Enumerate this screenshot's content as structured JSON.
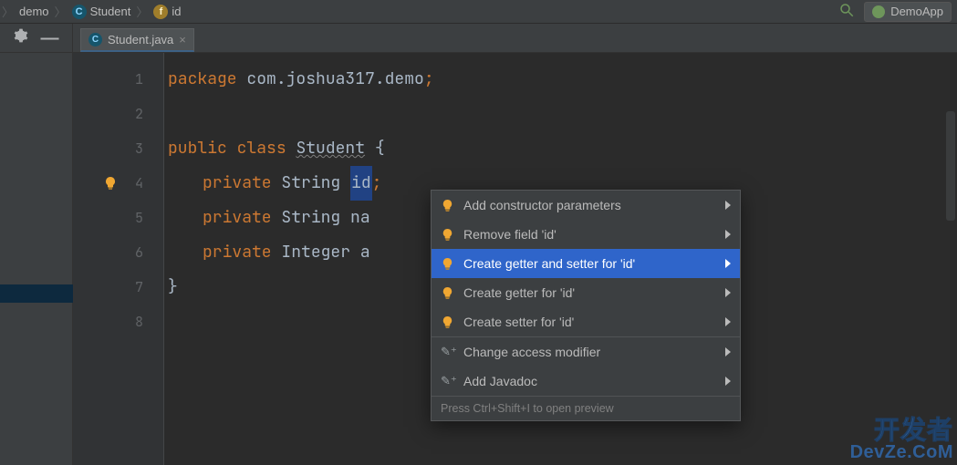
{
  "breadcrumb": {
    "items": [
      {
        "label": "demo",
        "icon": null
      },
      {
        "label": "Student",
        "icon": "class-icon"
      },
      {
        "label": "id",
        "icon": "field-icon"
      }
    ],
    "separator": "〉"
  },
  "toolbar": {
    "run_config_label": "DemoApp"
  },
  "tab": {
    "filename": "Student.java"
  },
  "editor": {
    "lines": [
      "1",
      "2",
      "3",
      "4",
      "5",
      "6",
      "7",
      "8"
    ],
    "kw_package": "package",
    "package_path": "com.joshua317.demo",
    "kw_public": "public",
    "kw_class": "class",
    "class_name": "Student",
    "kw_private": "private",
    "type_string": "String",
    "type_integer": "Integer",
    "field_id": "id",
    "field_name_trunc": "na",
    "field_age_trunc": "a",
    "brace_open": "{",
    "brace_close": "}",
    "semi": ";"
  },
  "popup": {
    "items": [
      {
        "icon": "bulb",
        "label": "Add constructor parameters",
        "selected": false
      },
      {
        "icon": "bulb",
        "label": "Remove field 'id'",
        "selected": false
      },
      {
        "icon": "bulb",
        "label": "Create getter and setter for 'id'",
        "selected": true
      },
      {
        "icon": "bulb",
        "label": "Create getter for 'id'",
        "selected": false
      },
      {
        "icon": "bulb",
        "label": "Create setter for 'id'",
        "selected": false
      },
      {
        "icon": "wand",
        "label": "Change access modifier",
        "selected": false
      },
      {
        "icon": "wand",
        "label": "Add Javadoc",
        "selected": false
      }
    ],
    "hint": "Press Ctrl+Shift+I to open preview"
  },
  "watermark": {
    "top": "开发者",
    "bottom": "DevZe.CoM"
  },
  "colors": {
    "bg_editor": "#2b2b2b",
    "bg_panel": "#3c3f41",
    "bg_gutter": "#313335",
    "accent_sel": "#2f65ca",
    "keyword": "#cc7832",
    "text": "#a9b7c6"
  }
}
